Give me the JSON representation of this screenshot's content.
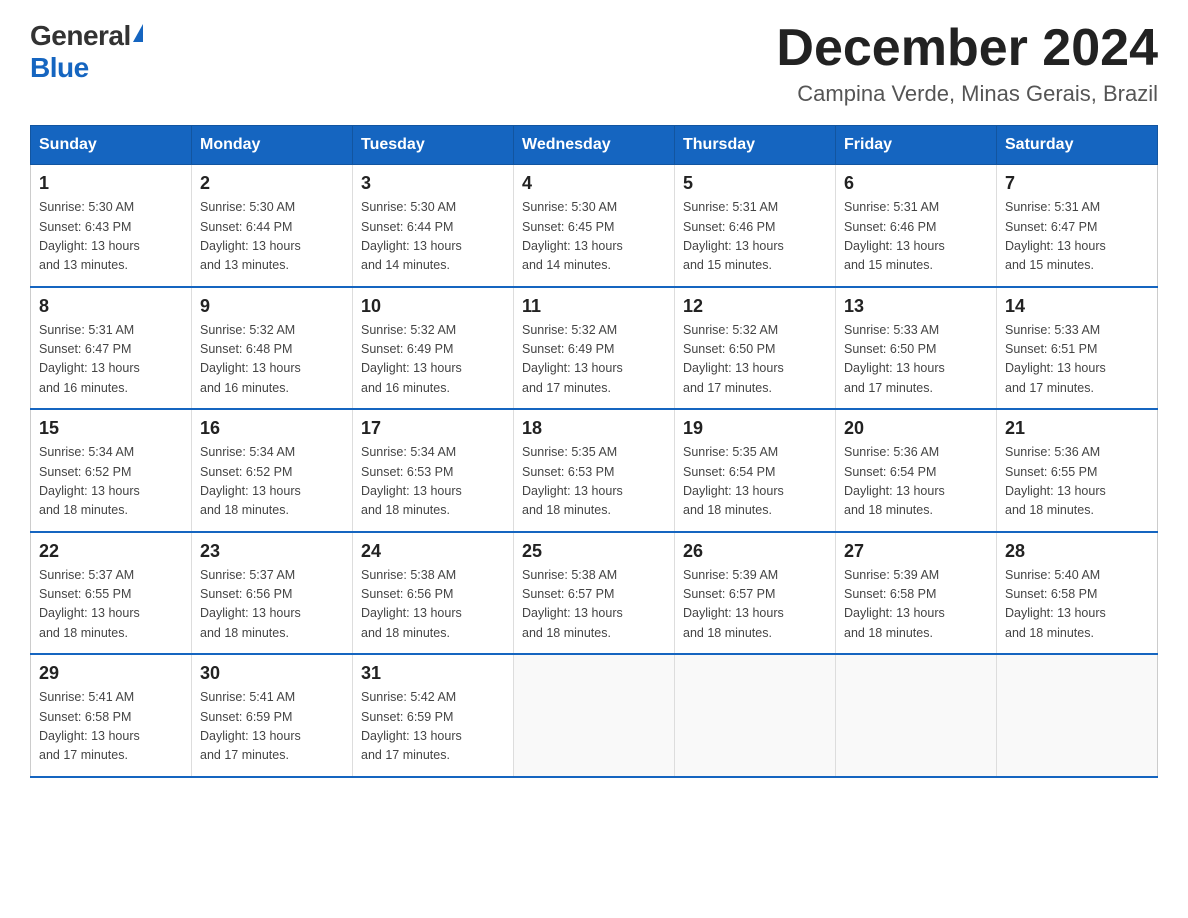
{
  "logo": {
    "general": "General",
    "blue": "Blue"
  },
  "title": "December 2024",
  "location": "Campina Verde, Minas Gerais, Brazil",
  "days_of_week": [
    "Sunday",
    "Monday",
    "Tuesday",
    "Wednesday",
    "Thursday",
    "Friday",
    "Saturday"
  ],
  "weeks": [
    [
      {
        "day": "1",
        "sunrise": "5:30 AM",
        "sunset": "6:43 PM",
        "daylight": "13 hours and 13 minutes."
      },
      {
        "day": "2",
        "sunrise": "5:30 AM",
        "sunset": "6:44 PM",
        "daylight": "13 hours and 13 minutes."
      },
      {
        "day": "3",
        "sunrise": "5:30 AM",
        "sunset": "6:44 PM",
        "daylight": "13 hours and 14 minutes."
      },
      {
        "day": "4",
        "sunrise": "5:30 AM",
        "sunset": "6:45 PM",
        "daylight": "13 hours and 14 minutes."
      },
      {
        "day": "5",
        "sunrise": "5:31 AM",
        "sunset": "6:46 PM",
        "daylight": "13 hours and 15 minutes."
      },
      {
        "day": "6",
        "sunrise": "5:31 AM",
        "sunset": "6:46 PM",
        "daylight": "13 hours and 15 minutes."
      },
      {
        "day": "7",
        "sunrise": "5:31 AM",
        "sunset": "6:47 PM",
        "daylight": "13 hours and 15 minutes."
      }
    ],
    [
      {
        "day": "8",
        "sunrise": "5:31 AM",
        "sunset": "6:47 PM",
        "daylight": "13 hours and 16 minutes."
      },
      {
        "day": "9",
        "sunrise": "5:32 AM",
        "sunset": "6:48 PM",
        "daylight": "13 hours and 16 minutes."
      },
      {
        "day": "10",
        "sunrise": "5:32 AM",
        "sunset": "6:49 PM",
        "daylight": "13 hours and 16 minutes."
      },
      {
        "day": "11",
        "sunrise": "5:32 AM",
        "sunset": "6:49 PM",
        "daylight": "13 hours and 17 minutes."
      },
      {
        "day": "12",
        "sunrise": "5:32 AM",
        "sunset": "6:50 PM",
        "daylight": "13 hours and 17 minutes."
      },
      {
        "day": "13",
        "sunrise": "5:33 AM",
        "sunset": "6:50 PM",
        "daylight": "13 hours and 17 minutes."
      },
      {
        "day": "14",
        "sunrise": "5:33 AM",
        "sunset": "6:51 PM",
        "daylight": "13 hours and 17 minutes."
      }
    ],
    [
      {
        "day": "15",
        "sunrise": "5:34 AM",
        "sunset": "6:52 PM",
        "daylight": "13 hours and 18 minutes."
      },
      {
        "day": "16",
        "sunrise": "5:34 AM",
        "sunset": "6:52 PM",
        "daylight": "13 hours and 18 minutes."
      },
      {
        "day": "17",
        "sunrise": "5:34 AM",
        "sunset": "6:53 PM",
        "daylight": "13 hours and 18 minutes."
      },
      {
        "day": "18",
        "sunrise": "5:35 AM",
        "sunset": "6:53 PM",
        "daylight": "13 hours and 18 minutes."
      },
      {
        "day": "19",
        "sunrise": "5:35 AM",
        "sunset": "6:54 PM",
        "daylight": "13 hours and 18 minutes."
      },
      {
        "day": "20",
        "sunrise": "5:36 AM",
        "sunset": "6:54 PM",
        "daylight": "13 hours and 18 minutes."
      },
      {
        "day": "21",
        "sunrise": "5:36 AM",
        "sunset": "6:55 PM",
        "daylight": "13 hours and 18 minutes."
      }
    ],
    [
      {
        "day": "22",
        "sunrise": "5:37 AM",
        "sunset": "6:55 PM",
        "daylight": "13 hours and 18 minutes."
      },
      {
        "day": "23",
        "sunrise": "5:37 AM",
        "sunset": "6:56 PM",
        "daylight": "13 hours and 18 minutes."
      },
      {
        "day": "24",
        "sunrise": "5:38 AM",
        "sunset": "6:56 PM",
        "daylight": "13 hours and 18 minutes."
      },
      {
        "day": "25",
        "sunrise": "5:38 AM",
        "sunset": "6:57 PM",
        "daylight": "13 hours and 18 minutes."
      },
      {
        "day": "26",
        "sunrise": "5:39 AM",
        "sunset": "6:57 PM",
        "daylight": "13 hours and 18 minutes."
      },
      {
        "day": "27",
        "sunrise": "5:39 AM",
        "sunset": "6:58 PM",
        "daylight": "13 hours and 18 minutes."
      },
      {
        "day": "28",
        "sunrise": "5:40 AM",
        "sunset": "6:58 PM",
        "daylight": "13 hours and 18 minutes."
      }
    ],
    [
      {
        "day": "29",
        "sunrise": "5:41 AM",
        "sunset": "6:58 PM",
        "daylight": "13 hours and 17 minutes."
      },
      {
        "day": "30",
        "sunrise": "5:41 AM",
        "sunset": "6:59 PM",
        "daylight": "13 hours and 17 minutes."
      },
      {
        "day": "31",
        "sunrise": "5:42 AM",
        "sunset": "6:59 PM",
        "daylight": "13 hours and 17 minutes."
      },
      null,
      null,
      null,
      null
    ]
  ]
}
